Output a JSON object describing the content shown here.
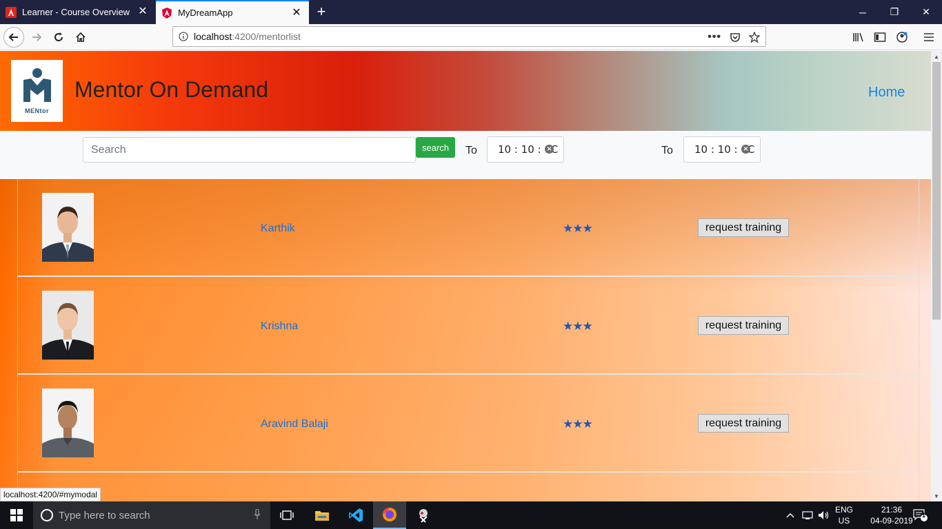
{
  "browser": {
    "tabs": [
      {
        "title": "Learner - Course Overview",
        "active": false
      },
      {
        "title": "MyDreamApp",
        "active": true
      }
    ],
    "url_host": "localhost",
    "url_path": ":4200/mentorlist",
    "status_url": "localhost:4200/#mymodal"
  },
  "header": {
    "logo_text": "MENtor",
    "brand": "Mentor On Demand",
    "home_link": "Home"
  },
  "search": {
    "placeholder": "Search",
    "button_label": "search",
    "to_label_1": "To",
    "time_1": "10 : 10 : 0C",
    "to_label_2": "To",
    "time_2": "10 : 10 : 0C"
  },
  "mentors": [
    {
      "name": "Karthik",
      "stars": "★★★",
      "rating": 3,
      "action": "request training"
    },
    {
      "name": "Krishna",
      "stars": "★★★",
      "rating": 3,
      "action": "request training"
    },
    {
      "name": "Aravind Balaji",
      "stars": "★★★",
      "rating": 3,
      "action": "request training"
    }
  ],
  "taskbar": {
    "search_placeholder": "Type here to search",
    "lang_line1": "ENG",
    "lang_line2": "US",
    "time": "21:36",
    "date": "04-09-2019",
    "notification_count": "1"
  },
  "colors": {
    "accent_blue": "#0a84ff",
    "search_green": "#28a745",
    "link_blue": "#1a6fd8",
    "star_blue": "#1f58b8"
  }
}
